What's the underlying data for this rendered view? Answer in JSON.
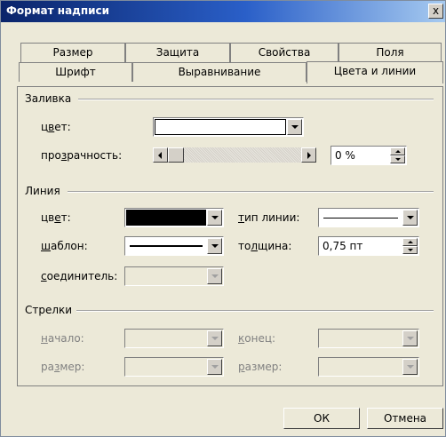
{
  "window": {
    "title": "Формат надписи",
    "close_label": "x"
  },
  "tabs": {
    "row1": [
      "Размер",
      "Защита",
      "Свойства",
      "Поля"
    ],
    "row2": [
      "Шрифт",
      "Выравнивание",
      "Цвета и линии"
    ],
    "active": "Цвета и линии"
  },
  "fill": {
    "section": "Заливка",
    "color_label_prefix": "ц",
    "color_label_u": "в",
    "color_label_suffix": "ет:",
    "transparency_label_prefix": "про",
    "transparency_label_u": "з",
    "transparency_label_suffix": "рачность:",
    "color_value": "#ffffff",
    "transparency_value": "0 %",
    "transparency_percent": 0
  },
  "line": {
    "section": "Линия",
    "color_label_prefix": "цв",
    "color_label_u": "е",
    "color_label_suffix": "т:",
    "color_value": "#000000",
    "type_label_prefix": "",
    "type_label_u": "т",
    "type_label_suffix": "ип линии:",
    "pattern_label_prefix": "",
    "pattern_label_u": "ш",
    "pattern_label_suffix": "аблон:",
    "weight_label_prefix": "то",
    "weight_label_u": "л",
    "weight_label_suffix": "щина:",
    "weight_value": "0,75 пт",
    "connector_label_prefix": "",
    "connector_label_u": "с",
    "connector_label_suffix": "оединитель:"
  },
  "arrows": {
    "section": "Стрелки",
    "begin_label_prefix": "",
    "begin_label_u": "н",
    "begin_label_suffix": "ачало:",
    "end_label_prefix": "",
    "end_label_u": "к",
    "end_label_suffix": "онец:",
    "begin_size_label_prefix": "ра",
    "begin_size_label_u": "з",
    "begin_size_label_suffix": "мер:",
    "end_size_label_prefix": "",
    "end_size_label_u": "р",
    "end_size_label_suffix": "азмер:"
  },
  "buttons": {
    "ok": "ОК",
    "cancel": "Отмена"
  }
}
